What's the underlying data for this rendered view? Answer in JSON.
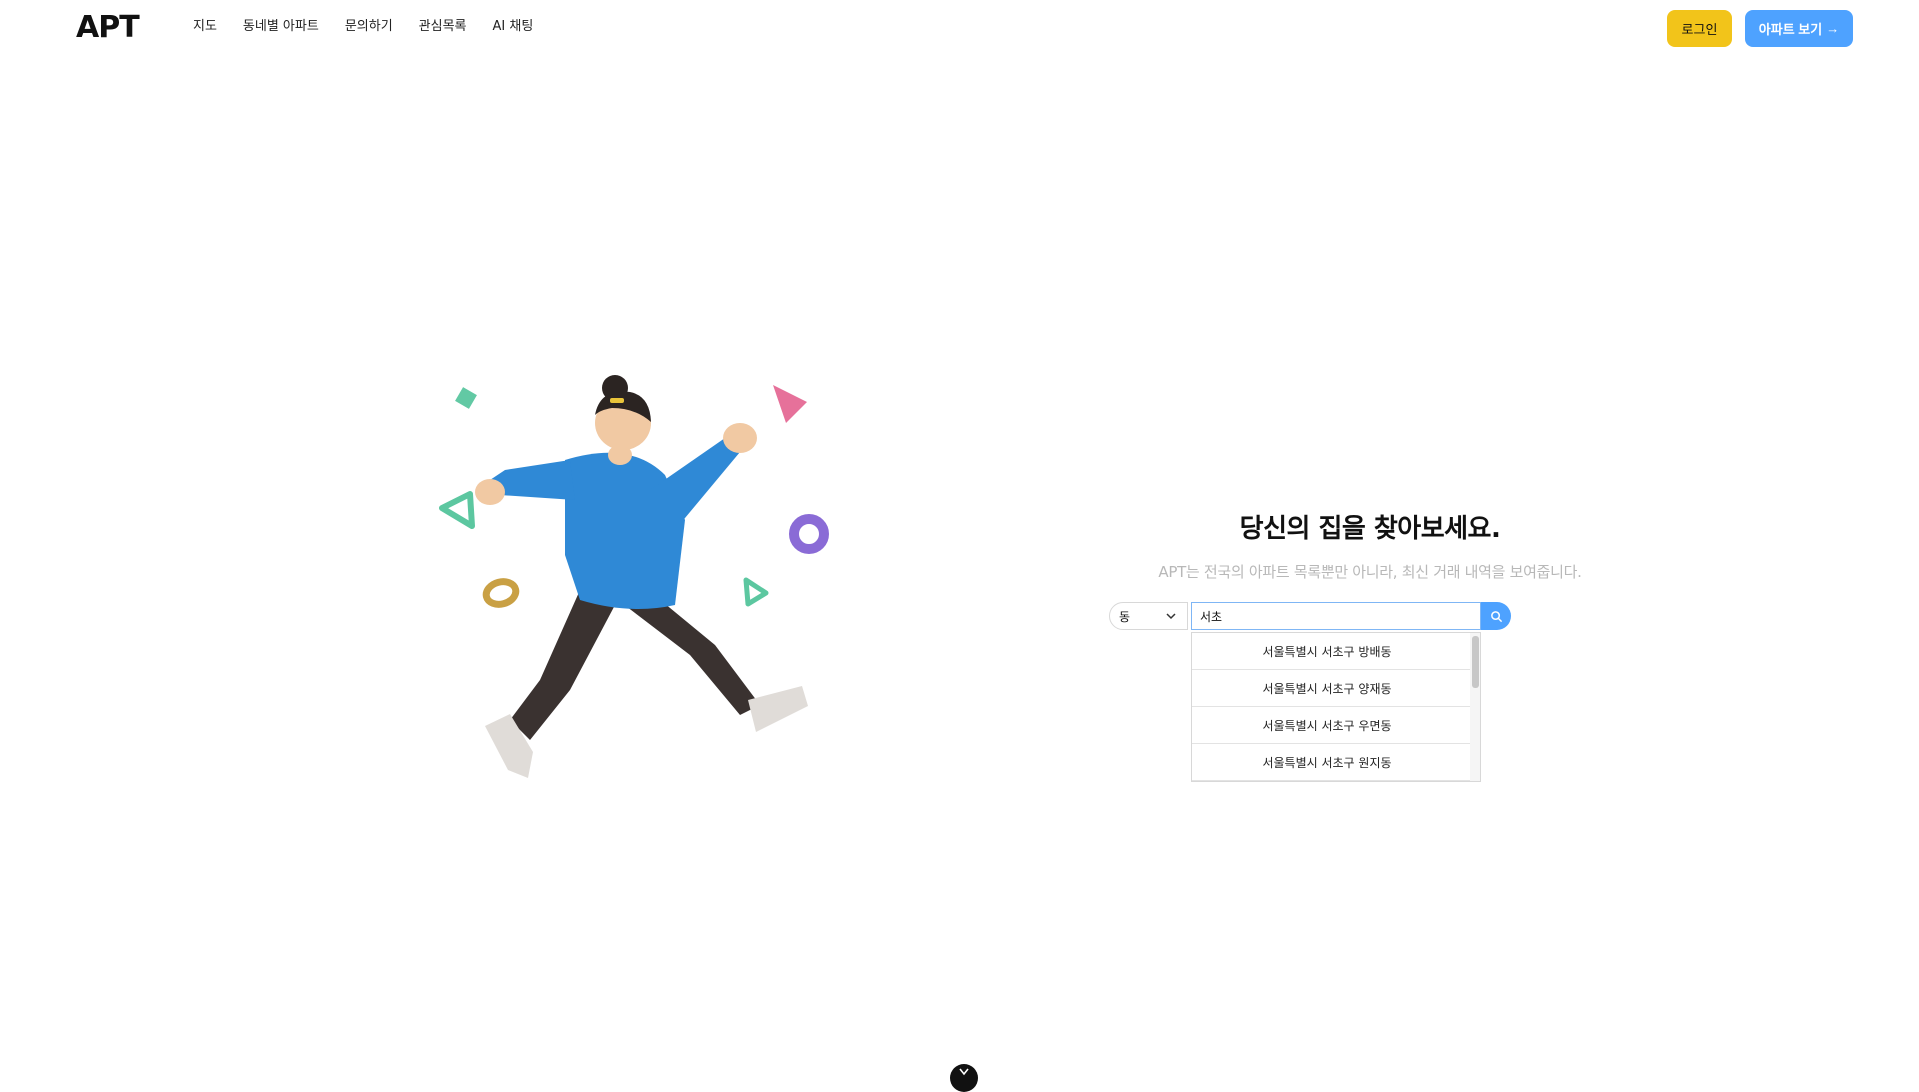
{
  "header": {
    "logo": "APT",
    "nav": [
      "지도",
      "동네별 아파트",
      "문의하기",
      "관심목록",
      "AI 채팅"
    ],
    "login_label": "로그인",
    "apt_label": "아파트 보기",
    "apt_arrow": "→"
  },
  "hero": {
    "title": "당신의 집을 찾아보세요.",
    "subtitle": "APT는 전국의 아파트 목록뿐만 아니라, 최신 거래 내역을 보여줍니다."
  },
  "search": {
    "select_value": "동",
    "input_value": "서초",
    "results": [
      "서울특별시 서초구 방배동",
      "서울특별시 서초구 양재동",
      "서울특별시 서초구 우면동",
      "서울특별시 서초구 원지동"
    ]
  },
  "colors": {
    "accent_yellow": "#f2c41a",
    "accent_blue": "#4ea2ff"
  },
  "icons": {
    "search": "search-icon",
    "chevron": "chevron-down-icon",
    "scroll": "scroll-down-icon"
  }
}
